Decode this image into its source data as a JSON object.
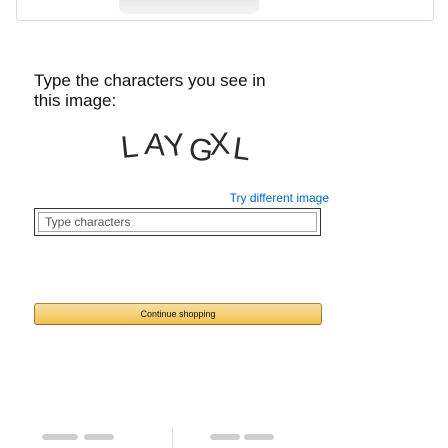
{
  "prompt": {
    "line1": "Type the characters you see in",
    "line2": "this image:"
  },
  "captcha": {
    "text": "LAYGXL"
  },
  "links": {
    "try_different": "Try different image"
  },
  "input": {
    "placeholder": "Type characters",
    "value": ""
  },
  "buttons": {
    "continue_label": "Continue shopping"
  },
  "colors": {
    "link": "#0066c0",
    "button_top": "#f7dfa5",
    "button_bottom": "#f0c14b",
    "button_border": "#a88734"
  }
}
